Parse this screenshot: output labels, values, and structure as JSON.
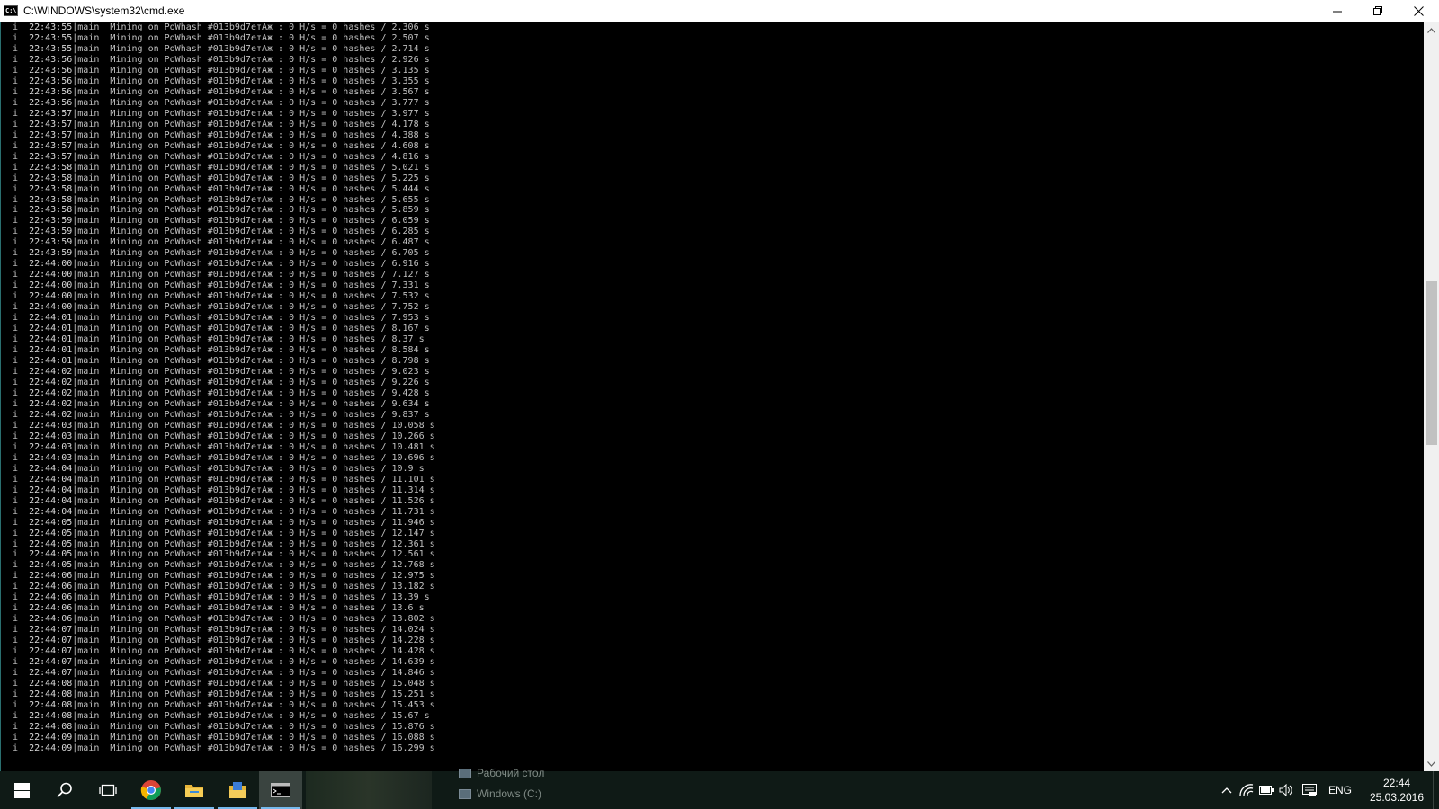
{
  "window": {
    "title": "C:\\WINDOWS\\system32\\cmd.exe",
    "icon_label": "C:\\",
    "icon": "cmd-icon",
    "minimize_icon": "minimize-icon",
    "restore_icon": "restore-icon",
    "close_icon": "close-icon"
  },
  "console": {
    "level": "i",
    "channel": "main",
    "message": "Mining on PoWhash #013b9d7eтАж : 0 H/s = 0 hashes / ",
    "unit": "s",
    "lines": [
      {
        "time": "22:43:55",
        "elapsed": "2.306"
      },
      {
        "time": "22:43:55",
        "elapsed": "2.507"
      },
      {
        "time": "22:43:55",
        "elapsed": "2.714"
      },
      {
        "time": "22:43:56",
        "elapsed": "2.926"
      },
      {
        "time": "22:43:56",
        "elapsed": "3.135"
      },
      {
        "time": "22:43:56",
        "elapsed": "3.355"
      },
      {
        "time": "22:43:56",
        "elapsed": "3.567"
      },
      {
        "time": "22:43:56",
        "elapsed": "3.777"
      },
      {
        "time": "22:43:57",
        "elapsed": "3.977"
      },
      {
        "time": "22:43:57",
        "elapsed": "4.178"
      },
      {
        "time": "22:43:57",
        "elapsed": "4.388"
      },
      {
        "time": "22:43:57",
        "elapsed": "4.608"
      },
      {
        "time": "22:43:57",
        "elapsed": "4.816"
      },
      {
        "time": "22:43:58",
        "elapsed": "5.021"
      },
      {
        "time": "22:43:58",
        "elapsed": "5.225"
      },
      {
        "time": "22:43:58",
        "elapsed": "5.444"
      },
      {
        "time": "22:43:58",
        "elapsed": "5.655"
      },
      {
        "time": "22:43:58",
        "elapsed": "5.859"
      },
      {
        "time": "22:43:59",
        "elapsed": "6.059"
      },
      {
        "time": "22:43:59",
        "elapsed": "6.285"
      },
      {
        "time": "22:43:59",
        "elapsed": "6.487"
      },
      {
        "time": "22:43:59",
        "elapsed": "6.705"
      },
      {
        "time": "22:44:00",
        "elapsed": "6.916"
      },
      {
        "time": "22:44:00",
        "elapsed": "7.127"
      },
      {
        "time": "22:44:00",
        "elapsed": "7.331"
      },
      {
        "time": "22:44:00",
        "elapsed": "7.532"
      },
      {
        "time": "22:44:00",
        "elapsed": "7.752"
      },
      {
        "time": "22:44:01",
        "elapsed": "7.953"
      },
      {
        "time": "22:44:01",
        "elapsed": "8.167"
      },
      {
        "time": "22:44:01",
        "elapsed": "8.37"
      },
      {
        "time": "22:44:01",
        "elapsed": "8.584"
      },
      {
        "time": "22:44:01",
        "elapsed": "8.798"
      },
      {
        "time": "22:44:02",
        "elapsed": "9.023"
      },
      {
        "time": "22:44:02",
        "elapsed": "9.226"
      },
      {
        "time": "22:44:02",
        "elapsed": "9.428"
      },
      {
        "time": "22:44:02",
        "elapsed": "9.634"
      },
      {
        "time": "22:44:02",
        "elapsed": "9.837"
      },
      {
        "time": "22:44:03",
        "elapsed": "10.058"
      },
      {
        "time": "22:44:03",
        "elapsed": "10.266"
      },
      {
        "time": "22:44:03",
        "elapsed": "10.481"
      },
      {
        "time": "22:44:03",
        "elapsed": "10.696"
      },
      {
        "time": "22:44:04",
        "elapsed": "10.9"
      },
      {
        "time": "22:44:04",
        "elapsed": "11.101"
      },
      {
        "time": "22:44:04",
        "elapsed": "11.314"
      },
      {
        "time": "22:44:04",
        "elapsed": "11.526"
      },
      {
        "time": "22:44:04",
        "elapsed": "11.731"
      },
      {
        "time": "22:44:05",
        "elapsed": "11.946"
      },
      {
        "time": "22:44:05",
        "elapsed": "12.147"
      },
      {
        "time": "22:44:05",
        "elapsed": "12.361"
      },
      {
        "time": "22:44:05",
        "elapsed": "12.561"
      },
      {
        "time": "22:44:05",
        "elapsed": "12.768"
      },
      {
        "time": "22:44:06",
        "elapsed": "12.975"
      },
      {
        "time": "22:44:06",
        "elapsed": "13.182"
      },
      {
        "time": "22:44:06",
        "elapsed": "13.39"
      },
      {
        "time": "22:44:06",
        "elapsed": "13.6"
      },
      {
        "time": "22:44:06",
        "elapsed": "13.802"
      },
      {
        "time": "22:44:07",
        "elapsed": "14.024"
      },
      {
        "time": "22:44:07",
        "elapsed": "14.228"
      },
      {
        "time": "22:44:07",
        "elapsed": "14.428"
      },
      {
        "time": "22:44:07",
        "elapsed": "14.639"
      },
      {
        "time": "22:44:07",
        "elapsed": "14.846"
      },
      {
        "time": "22:44:08",
        "elapsed": "15.048"
      },
      {
        "time": "22:44:08",
        "elapsed": "15.251"
      },
      {
        "time": "22:44:08",
        "elapsed": "15.453"
      },
      {
        "time": "22:44:08",
        "elapsed": "15.67"
      },
      {
        "time": "22:44:08",
        "elapsed": "15.876"
      },
      {
        "time": "22:44:09",
        "elapsed": "16.088"
      },
      {
        "time": "22:44:09",
        "elapsed": "16.299"
      }
    ]
  },
  "scrollbar": {
    "up_icon": "scroll-up-arrow-icon",
    "down_icon": "scroll-down-arrow-icon",
    "position_fraction": 0.44
  },
  "taskbar": {
    "start_icon": "windows-start-icon",
    "search_icon": "search-icon",
    "task_view_icon": "task-view-icon",
    "apps": [
      {
        "name": "chrome-icon"
      },
      {
        "name": "file-explorer-icon"
      },
      {
        "name": "folder-app-icon"
      },
      {
        "name": "cmd-taskbar-icon"
      }
    ],
    "desktop_items": [
      "Рабочий стол",
      "Windows (C:)"
    ],
    "tray": {
      "chevron_icon": "show-hidden-icons-chevron-icon",
      "network_icon": "network-icon",
      "battery_icon": "battery-icon",
      "volume_icon": "volume-icon",
      "notification_icon": "action-center-icon",
      "language": "ENG",
      "time": "22:44",
      "date": "25.03.2016"
    }
  },
  "colors": {
    "console_bg": "#000000",
    "console_text": "#c0c0c0",
    "taskbar_bg": "#0f1a16",
    "accent": "#76b9ed"
  }
}
